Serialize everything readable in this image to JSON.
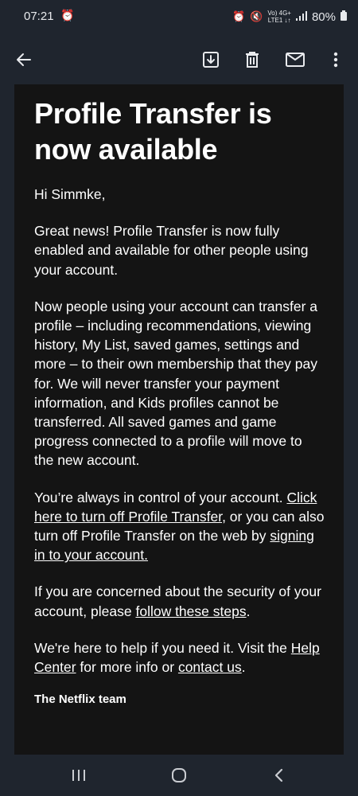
{
  "status": {
    "time": "07:21",
    "net_top": "Vo) 4G+",
    "net_bottom": "LTE1 ↓↑",
    "battery": "80%"
  },
  "toolbar": {
    "back_icon": "arrow-back-icon",
    "archive_icon": "archive-icon",
    "delete_icon": "trash-icon",
    "mail_icon": "mail-icon",
    "more_icon": "more-vert-icon"
  },
  "email": {
    "title": "Profile Transfer is now available",
    "greeting": "Hi Simmke,",
    "p1": "Great news! Profile Transfer is now fully enabled and available for other people using your account.",
    "p2": "Now people using your account can transfer a profile – including recommendations, viewing history, My List, saved games, settings and more – to their own membership that they pay for. We will never transfer your payment information, and Kids profiles cannot be transferred. All saved games and game progress connected to a profile will move to the new account.",
    "p3_a": "You’re always in control of your account.",
    "p3_link1": "Click here to turn off Profile Transfer",
    "p3_b": ", or you can also turn off Profile Transfer on the web by",
    "p3_link2": "signing in to your account.",
    "p4_a": "If you are concerned about the security of your account, please",
    "p4_link": "follow these steps",
    "p4_b": ".",
    "p5_a": "We're here to help if you need it. Visit the",
    "p5_link1": "Help Center",
    "p5_b": "for more info or",
    "p5_link2": "contact us",
    "p5_c": ".",
    "signature": "The Netflix team"
  },
  "navbar": {
    "recents_icon": "recents-icon",
    "home_icon": "home-icon",
    "back_icon": "nav-back-icon"
  },
  "colors": {
    "chrome_bg": "#1f252e",
    "email_bg": "#141414",
    "text": "#ffffff"
  }
}
